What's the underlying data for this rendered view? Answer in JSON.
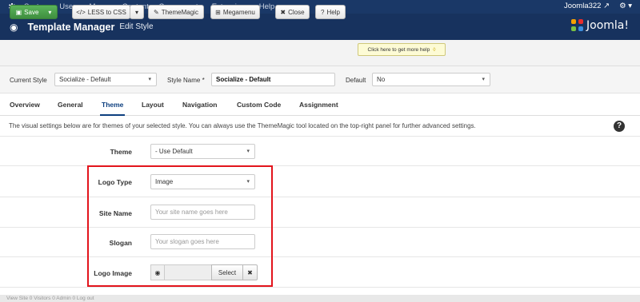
{
  "topnav": {
    "items": [
      "System",
      "Users",
      "Menus",
      "Content",
      "Components",
      "Extensions",
      "Help"
    ],
    "user": "Joomla322 ↗",
    "gear": "⚙ ▾"
  },
  "header": {
    "title": "Template Manager",
    "subtitle": "Edit Style",
    "brand": "Joomla!"
  },
  "toolbar": {
    "save": "Save",
    "less_to_css": "LESS to CSS",
    "thememagic": "ThemeMagic",
    "megamenu": "Megamenu",
    "close": "Close",
    "help": "Help",
    "help_hint": "Click here to get more help"
  },
  "filters": {
    "current_style_label": "Current Style",
    "current_style_value": "Socialize - Default",
    "style_name_label": "Style Name *",
    "style_name_value": "Socialize - Default",
    "default_label": "Default",
    "default_value": "No"
  },
  "tabs": [
    "Overview",
    "General",
    "Theme",
    "Layout",
    "Navigation",
    "Custom Code",
    "Assignment"
  ],
  "active_tab": "Theme",
  "description": "The visual settings below are for themes of your selected style. You can always use the ThemeMagic tool located on the top-right panel for further advanced settings.",
  "form": {
    "theme_label": "Theme",
    "theme_value": "- Use Default",
    "logo_type_label": "Logo Type",
    "logo_type_value": "Image",
    "site_name_label": "Site Name",
    "site_name_placeholder": "Your site name goes here",
    "slogan_label": "Slogan",
    "slogan_placeholder": "Your slogan goes here",
    "logo_image_label": "Logo Image",
    "select_button": "Select",
    "clear_button": "✖"
  },
  "footer": "View Site  0 Visitors  0 Admin  0 Log out",
  "colors": {
    "nav": "#1a3867",
    "header": "#17325e",
    "save": "#4a9f4a",
    "highlight": "#e2141c"
  }
}
